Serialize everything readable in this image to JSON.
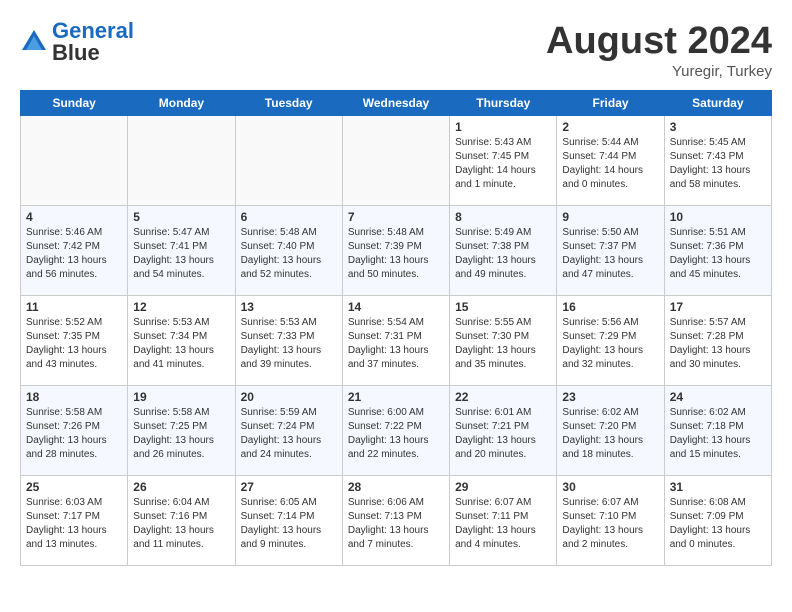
{
  "header": {
    "logo_line1": "General",
    "logo_line2": "Blue",
    "month": "August 2024",
    "location": "Yuregir, Turkey"
  },
  "days_of_week": [
    "Sunday",
    "Monday",
    "Tuesday",
    "Wednesday",
    "Thursday",
    "Friday",
    "Saturday"
  ],
  "weeks": [
    [
      {
        "day": "",
        "empty": true
      },
      {
        "day": "",
        "empty": true
      },
      {
        "day": "",
        "empty": true
      },
      {
        "day": "",
        "empty": true
      },
      {
        "day": "1",
        "sunrise": "5:43 AM",
        "sunset": "7:45 PM",
        "daylight": "14 hours and 1 minute."
      },
      {
        "day": "2",
        "sunrise": "5:44 AM",
        "sunset": "7:44 PM",
        "daylight": "14 hours and 0 minutes."
      },
      {
        "day": "3",
        "sunrise": "5:45 AM",
        "sunset": "7:43 PM",
        "daylight": "13 hours and 58 minutes."
      }
    ],
    [
      {
        "day": "4",
        "sunrise": "5:46 AM",
        "sunset": "7:42 PM",
        "daylight": "13 hours and 56 minutes."
      },
      {
        "day": "5",
        "sunrise": "5:47 AM",
        "sunset": "7:41 PM",
        "daylight": "13 hours and 54 minutes."
      },
      {
        "day": "6",
        "sunrise": "5:48 AM",
        "sunset": "7:40 PM",
        "daylight": "13 hours and 52 minutes."
      },
      {
        "day": "7",
        "sunrise": "5:48 AM",
        "sunset": "7:39 PM",
        "daylight": "13 hours and 50 minutes."
      },
      {
        "day": "8",
        "sunrise": "5:49 AM",
        "sunset": "7:38 PM",
        "daylight": "13 hours and 49 minutes."
      },
      {
        "day": "9",
        "sunrise": "5:50 AM",
        "sunset": "7:37 PM",
        "daylight": "13 hours and 47 minutes."
      },
      {
        "day": "10",
        "sunrise": "5:51 AM",
        "sunset": "7:36 PM",
        "daylight": "13 hours and 45 minutes."
      }
    ],
    [
      {
        "day": "11",
        "sunrise": "5:52 AM",
        "sunset": "7:35 PM",
        "daylight": "13 hours and 43 minutes."
      },
      {
        "day": "12",
        "sunrise": "5:53 AM",
        "sunset": "7:34 PM",
        "daylight": "13 hours and 41 minutes."
      },
      {
        "day": "13",
        "sunrise": "5:53 AM",
        "sunset": "7:33 PM",
        "daylight": "13 hours and 39 minutes."
      },
      {
        "day": "14",
        "sunrise": "5:54 AM",
        "sunset": "7:31 PM",
        "daylight": "13 hours and 37 minutes."
      },
      {
        "day": "15",
        "sunrise": "5:55 AM",
        "sunset": "7:30 PM",
        "daylight": "13 hours and 35 minutes."
      },
      {
        "day": "16",
        "sunrise": "5:56 AM",
        "sunset": "7:29 PM",
        "daylight": "13 hours and 32 minutes."
      },
      {
        "day": "17",
        "sunrise": "5:57 AM",
        "sunset": "7:28 PM",
        "daylight": "13 hours and 30 minutes."
      }
    ],
    [
      {
        "day": "18",
        "sunrise": "5:58 AM",
        "sunset": "7:26 PM",
        "daylight": "13 hours and 28 minutes."
      },
      {
        "day": "19",
        "sunrise": "5:58 AM",
        "sunset": "7:25 PM",
        "daylight": "13 hours and 26 minutes."
      },
      {
        "day": "20",
        "sunrise": "5:59 AM",
        "sunset": "7:24 PM",
        "daylight": "13 hours and 24 minutes."
      },
      {
        "day": "21",
        "sunrise": "6:00 AM",
        "sunset": "7:22 PM",
        "daylight": "13 hours and 22 minutes."
      },
      {
        "day": "22",
        "sunrise": "6:01 AM",
        "sunset": "7:21 PM",
        "daylight": "13 hours and 20 minutes."
      },
      {
        "day": "23",
        "sunrise": "6:02 AM",
        "sunset": "7:20 PM",
        "daylight": "13 hours and 18 minutes."
      },
      {
        "day": "24",
        "sunrise": "6:02 AM",
        "sunset": "7:18 PM",
        "daylight": "13 hours and 15 minutes."
      }
    ],
    [
      {
        "day": "25",
        "sunrise": "6:03 AM",
        "sunset": "7:17 PM",
        "daylight": "13 hours and 13 minutes."
      },
      {
        "day": "26",
        "sunrise": "6:04 AM",
        "sunset": "7:16 PM",
        "daylight": "13 hours and 11 minutes."
      },
      {
        "day": "27",
        "sunrise": "6:05 AM",
        "sunset": "7:14 PM",
        "daylight": "13 hours and 9 minutes."
      },
      {
        "day": "28",
        "sunrise": "6:06 AM",
        "sunset": "7:13 PM",
        "daylight": "13 hours and 7 minutes."
      },
      {
        "day": "29",
        "sunrise": "6:07 AM",
        "sunset": "7:11 PM",
        "daylight": "13 hours and 4 minutes."
      },
      {
        "day": "30",
        "sunrise": "6:07 AM",
        "sunset": "7:10 PM",
        "daylight": "13 hours and 2 minutes."
      },
      {
        "day": "31",
        "sunrise": "6:08 AM",
        "sunset": "7:09 PM",
        "daylight": "13 hours and 0 minutes."
      }
    ]
  ]
}
